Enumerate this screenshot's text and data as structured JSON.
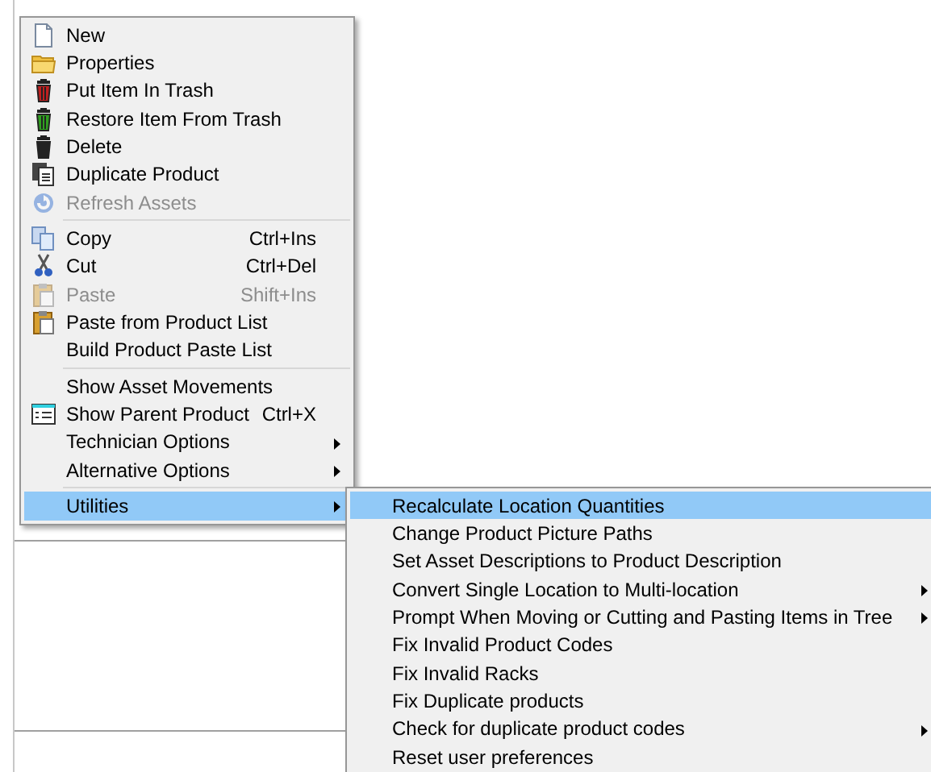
{
  "context_menu": {
    "items": [
      {
        "kind": "item",
        "label": "New",
        "disabled": false,
        "selected": false
      },
      {
        "kind": "item",
        "label": "Properties",
        "disabled": false,
        "selected": false
      },
      {
        "kind": "item",
        "label": "Put Item In Trash",
        "disabled": false,
        "selected": false
      },
      {
        "kind": "item",
        "label": "Restore Item From Trash",
        "disabled": false,
        "selected": false
      },
      {
        "kind": "item",
        "label": "Delete",
        "disabled": false,
        "selected": false
      },
      {
        "kind": "item",
        "label": "Duplicate Product",
        "disabled": false,
        "selected": false
      },
      {
        "kind": "item",
        "label": "Refresh Assets",
        "disabled": true,
        "selected": false
      },
      {
        "kind": "separator"
      },
      {
        "kind": "item",
        "label": "Copy",
        "shortcut": "Ctrl+Ins",
        "disabled": false,
        "selected": false
      },
      {
        "kind": "item",
        "label": "Cut",
        "shortcut": "Ctrl+Del",
        "disabled": false,
        "selected": false
      },
      {
        "kind": "item",
        "label": "Paste",
        "shortcut": "Shift+Ins",
        "disabled": true,
        "selected": false
      },
      {
        "kind": "item",
        "label": "Paste from Product List",
        "disabled": false,
        "selected": false
      },
      {
        "kind": "item",
        "label": "Build Product Paste List",
        "disabled": false,
        "selected": false
      },
      {
        "kind": "separator"
      },
      {
        "kind": "item",
        "label": "Show Asset Movements",
        "disabled": false,
        "selected": false
      },
      {
        "kind": "item",
        "label": "Show Parent Product",
        "shortcut": "Ctrl+X",
        "disabled": false,
        "selected": false
      },
      {
        "kind": "submenu",
        "label": "Technician Options",
        "disabled": false,
        "selected": false
      },
      {
        "kind": "submenu",
        "label": "Alternative Options",
        "disabled": false,
        "selected": false
      },
      {
        "kind": "separator"
      },
      {
        "kind": "submenu",
        "label": "Utilities",
        "disabled": false,
        "selected": true
      }
    ]
  },
  "utilities_submenu": {
    "items": [
      {
        "kind": "item",
        "label": "Recalculate Location Quantities",
        "selected": true
      },
      {
        "kind": "item",
        "label": "Change Product Picture Paths",
        "selected": false
      },
      {
        "kind": "item",
        "label": "Set Asset Descriptions to Product Description",
        "selected": false
      },
      {
        "kind": "submenu",
        "label": "Convert Single Location to Multi-location",
        "selected": false
      },
      {
        "kind": "submenu",
        "label": "Prompt When Moving or Cutting and Pasting Items in Tree",
        "selected": false
      },
      {
        "kind": "item",
        "label": "Fix Invalid Product Codes",
        "selected": false
      },
      {
        "kind": "item",
        "label": "Fix Invalid Racks",
        "selected": false
      },
      {
        "kind": "item",
        "label": "Fix Duplicate products",
        "selected": false
      },
      {
        "kind": "submenu",
        "label": "Check for duplicate product codes",
        "selected": false
      },
      {
        "kind": "item",
        "label": "Reset user preferences",
        "selected": false
      }
    ]
  }
}
